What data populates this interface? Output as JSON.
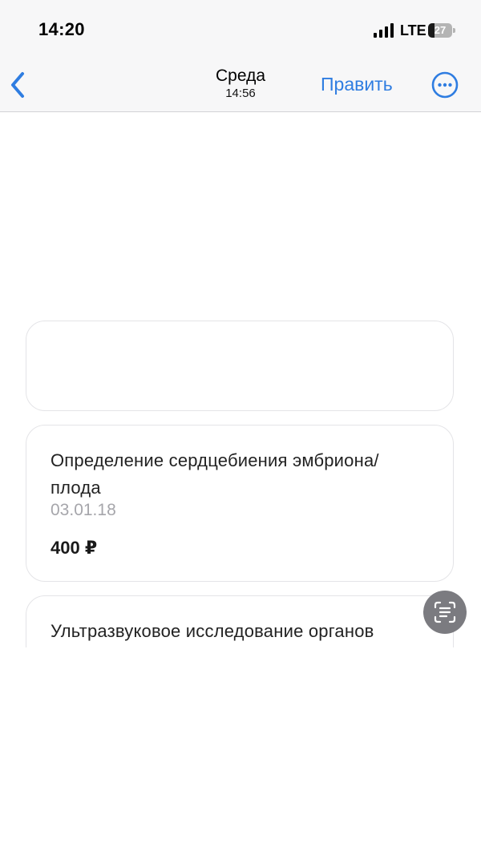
{
  "status_bar": {
    "time": "14:20",
    "network": "LTE",
    "battery_level": "27",
    "battery_fraction": 0.27,
    "signal_bars": 4
  },
  "nav": {
    "back_icon": "chevron-left-icon",
    "title": "Среда",
    "subtitle": "14:56",
    "edit_label": "Править",
    "more_icon": "ellipsis-circle-icon",
    "accent_color": "#2f7de1"
  },
  "cards": [
    {
      "title": "Определение сердцебиения эмбриона/плода",
      "date": "03.01.18",
      "price": "400 ₽"
    },
    {
      "title": "Ультразвуковое исследование органов"
    }
  ],
  "scan_button": {
    "icon": "text-scan-icon"
  }
}
